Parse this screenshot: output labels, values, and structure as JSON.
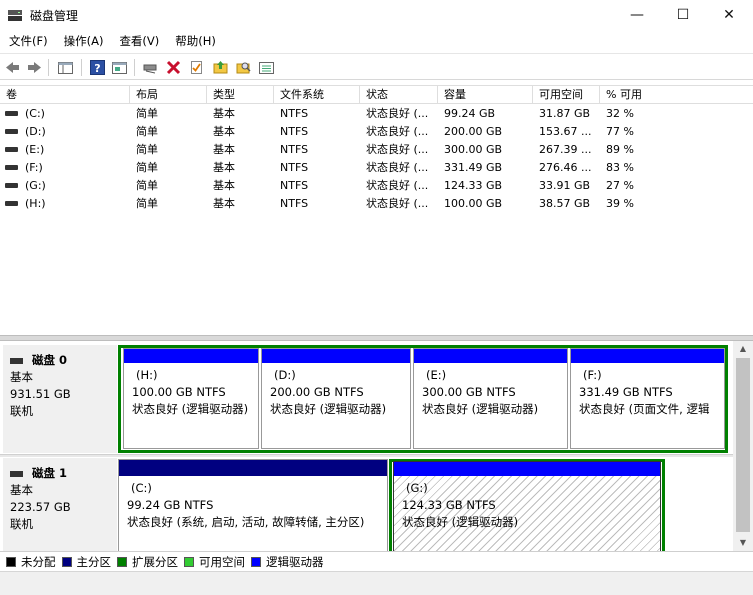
{
  "window": {
    "title": "磁盘管理",
    "min_glyph": "—",
    "max_glyph": "☐",
    "close_glyph": "✕"
  },
  "menu": [
    "文件(F)",
    "操作(A)",
    "查看(V)",
    "帮助(H)"
  ],
  "toolbar_icons": [
    "back-icon",
    "forward-icon",
    "console-tree-icon",
    "help-icon",
    "properties-icon",
    "connect-icon",
    "delete-icon",
    "checklist-icon",
    "open-icon",
    "search-icon",
    "list-icon"
  ],
  "columns": [
    "卷",
    "布局",
    "类型",
    "文件系统",
    "状态",
    "容量",
    "可用空间",
    "% 可用"
  ],
  "volumes": [
    {
      "vol": "(C:)",
      "layout": "简单",
      "type": "基本",
      "fs": "NTFS",
      "status": "状态良好 (...",
      "capacity": "99.24 GB",
      "free": "31.87 GB",
      "pct": "32 %"
    },
    {
      "vol": "(D:)",
      "layout": "简单",
      "type": "基本",
      "fs": "NTFS",
      "status": "状态良好 (...",
      "capacity": "200.00 GB",
      "free": "153.67 ...",
      "pct": "77 %"
    },
    {
      "vol": "(E:)",
      "layout": "简单",
      "type": "基本",
      "fs": "NTFS",
      "status": "状态良好 (...",
      "capacity": "300.00 GB",
      "free": "267.39 ...",
      "pct": "89 %"
    },
    {
      "vol": "(F:)",
      "layout": "简单",
      "type": "基本",
      "fs": "NTFS",
      "status": "状态良好 (...",
      "capacity": "331.49 GB",
      "free": "276.46 ...",
      "pct": "83 %"
    },
    {
      "vol": "(G:)",
      "layout": "简单",
      "type": "基本",
      "fs": "NTFS",
      "status": "状态良好 (...",
      "capacity": "124.33 GB",
      "free": "33.91 GB",
      "pct": "27 %"
    },
    {
      "vol": "(H:)",
      "layout": "简单",
      "type": "基本",
      "fs": "NTFS",
      "status": "状态良好 (...",
      "capacity": "100.00 GB",
      "free": "38.57 GB",
      "pct": "39 %"
    }
  ],
  "disks": [
    {
      "name": "磁盘 0",
      "type": "基本",
      "size": "931.51 GB",
      "state": "联机",
      "partitions": [
        {
          "label": "(H:)",
          "size_fs": "100.00 GB NTFS",
          "status": "状态良好 (逻辑驱动器)"
        },
        {
          "label": "(D:)",
          "size_fs": "200.00 GB NTFS",
          "status": "状态良好 (逻辑驱动器)"
        },
        {
          "label": "(E:)",
          "size_fs": "300.00 GB NTFS",
          "status": "状态良好 (逻辑驱动器)"
        },
        {
          "label": "(F:)",
          "size_fs": "331.49 GB NTFS",
          "status": "状态良好 (页面文件, 逻辑"
        }
      ]
    },
    {
      "name": "磁盘 1",
      "type": "基本",
      "size": "223.57 GB",
      "state": "联机",
      "partitions": [
        {
          "label": "(C:)",
          "size_fs": "99.24 GB NTFS",
          "status": "状态良好 (系统, 启动, 活动, 故障转储, 主分区)"
        },
        {
          "label": "(G:)",
          "size_fs": "124.33 GB NTFS",
          "status": "状态良好 (逻辑驱动器)"
        }
      ]
    }
  ],
  "legend": [
    {
      "label": "未分配",
      "color": "#000000"
    },
    {
      "label": "主分区",
      "color": "#000080"
    },
    {
      "label": "扩展分区",
      "color": "#008000"
    },
    {
      "label": "可用空间",
      "color": "#33cc33"
    },
    {
      "label": "逻辑驱动器",
      "color": "#0000ff"
    }
  ],
  "colors": {
    "primary": "#000080",
    "logical": "#0000ff",
    "extended": "#008000",
    "free_space": "#33cc33"
  }
}
